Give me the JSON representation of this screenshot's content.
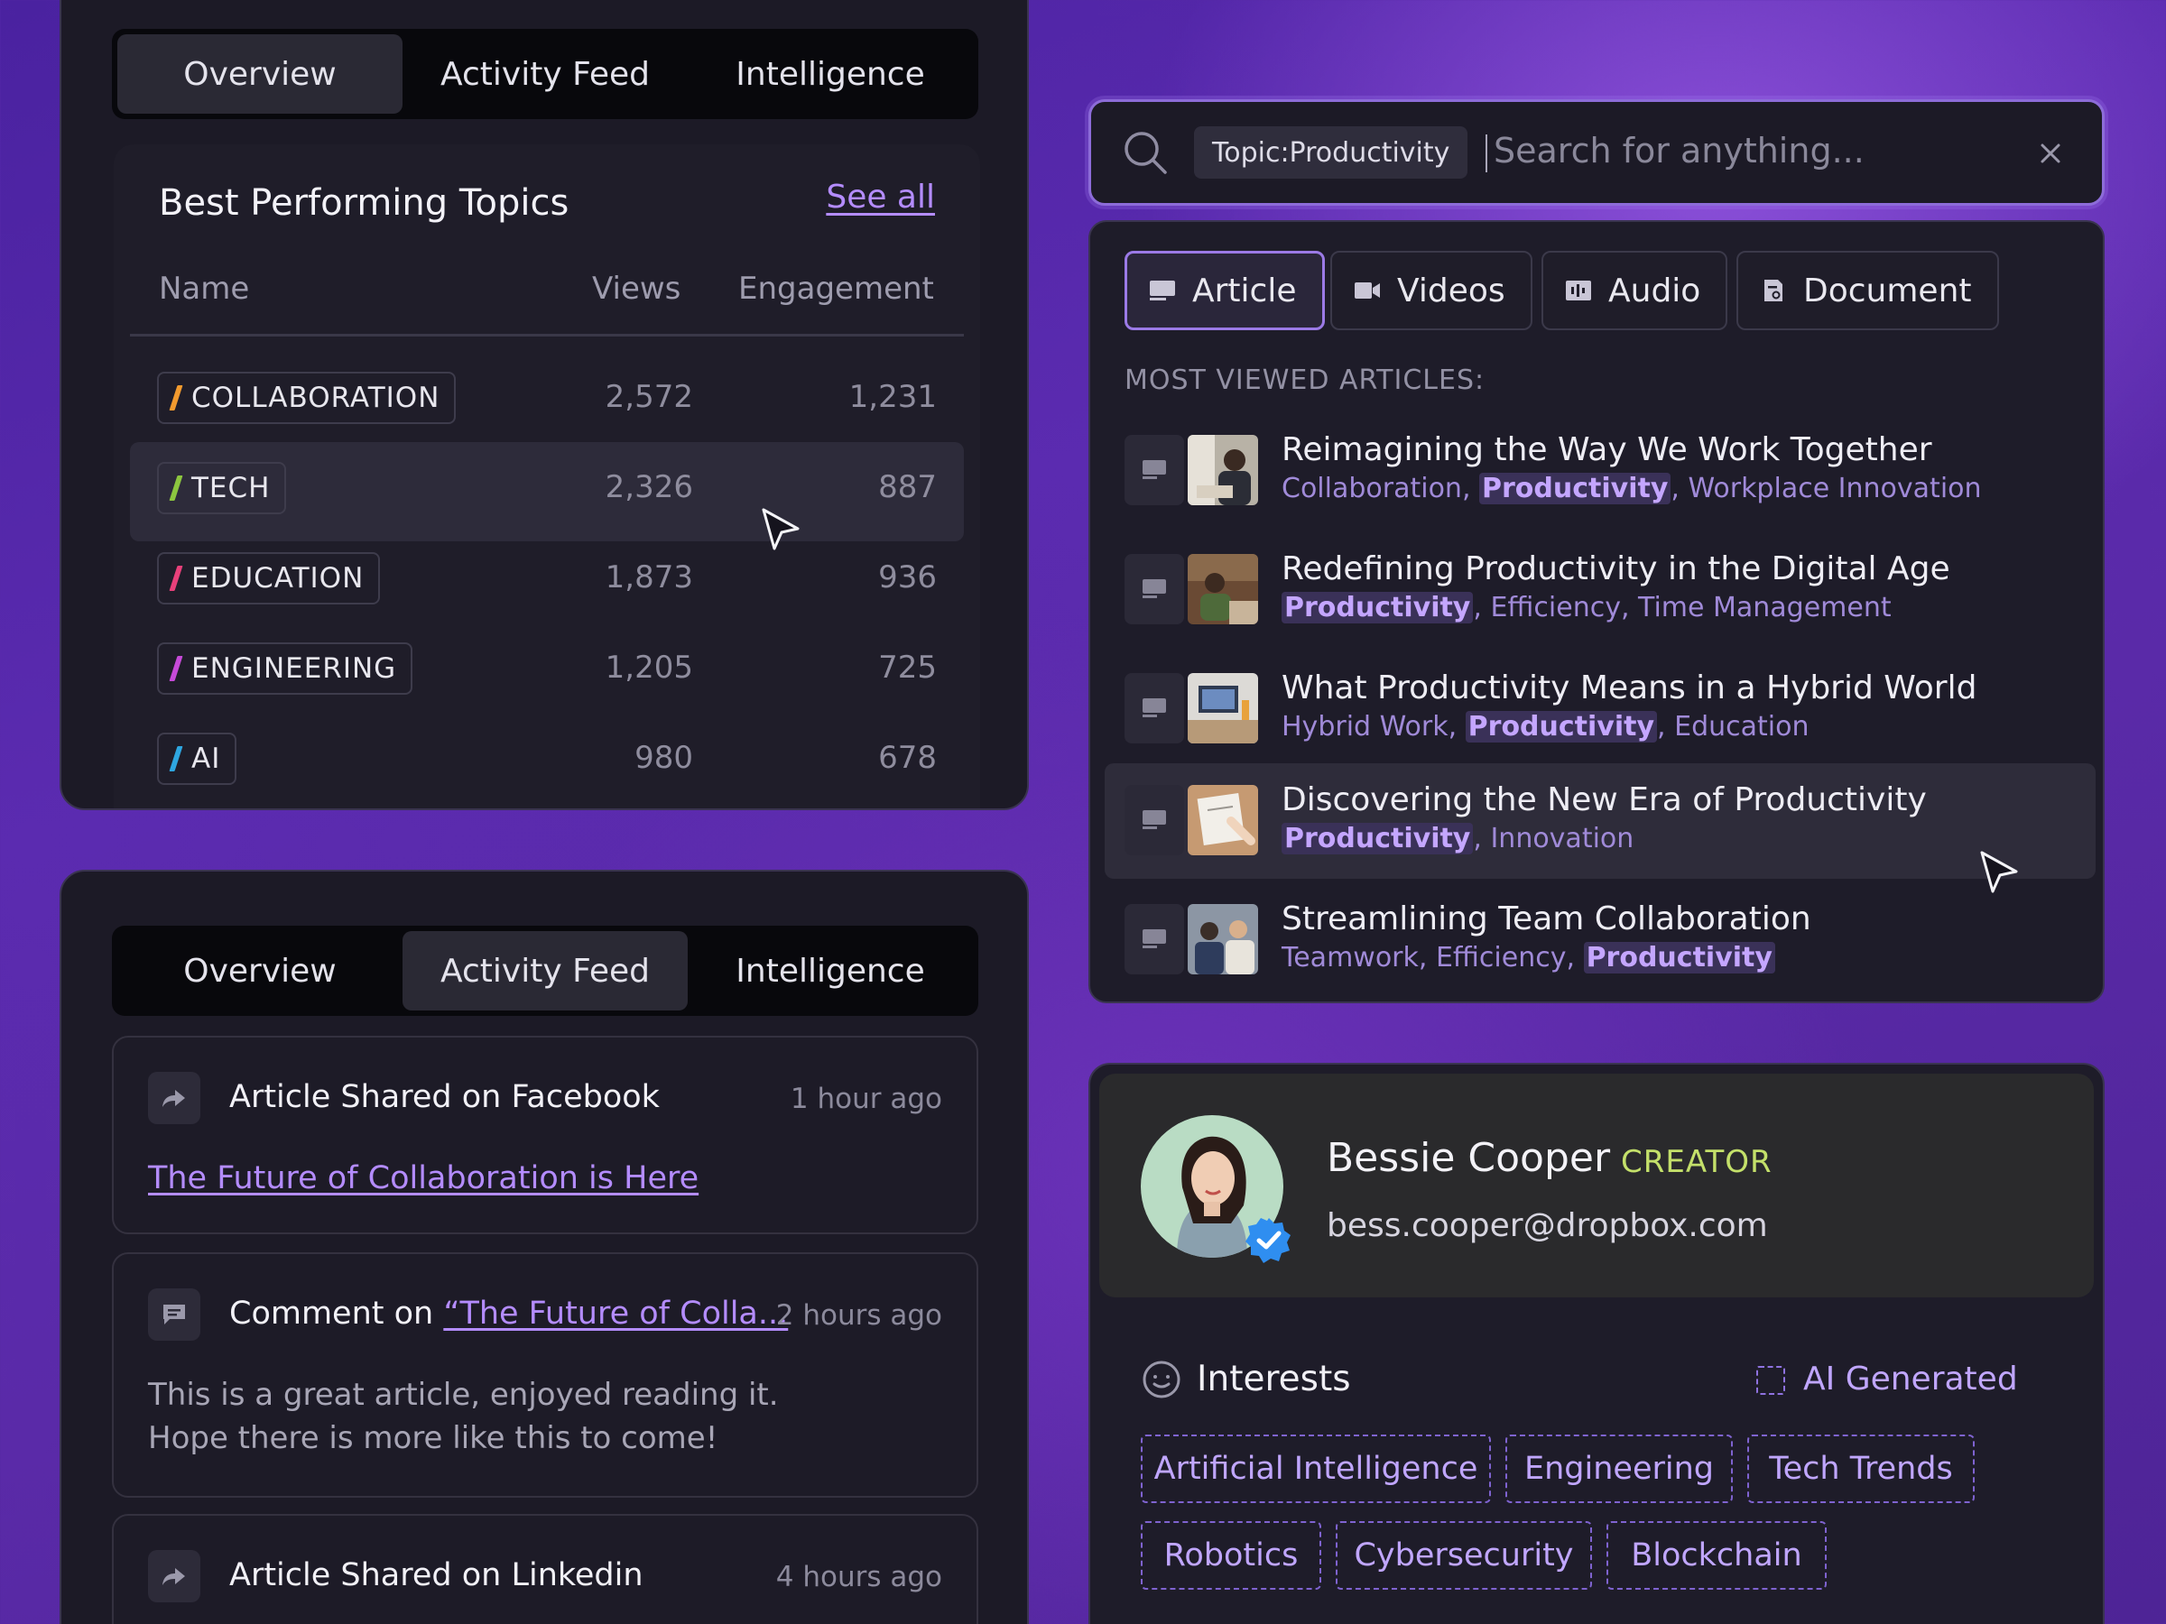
{
  "tabs": [
    "Overview",
    "Activity Feed",
    "Intelligence"
  ],
  "topics": {
    "title": "Best Performing Topics",
    "see_all": "See all",
    "columns": {
      "name": "Name",
      "views": "Views",
      "engagement": "Engagement"
    },
    "rows": [
      {
        "name": "COLLABORATION",
        "views": "2,572",
        "engagement": "1,231",
        "color": "#f29a2e"
      },
      {
        "name": "TECH",
        "views": "2,326",
        "engagement": "887",
        "color": "#8cc63f"
      },
      {
        "name": "EDUCATION",
        "views": "1,873",
        "engagement": "936",
        "color": "#e8407a"
      },
      {
        "name": "ENGINEERING",
        "views": "1,205",
        "engagement": "725",
        "color": "#c64ad8"
      },
      {
        "name": "AI",
        "views": "980",
        "engagement": "678",
        "color": "#2ea6e0"
      }
    ]
  },
  "feed": [
    {
      "title": "Article Shared on Facebook",
      "time": "1 hour ago",
      "link": "The Future of Collaboration is Here",
      "icon": "share-icon"
    },
    {
      "title_prefix": "Comment on ",
      "title_link": "“The Future of Colla...",
      "time": "2 hours ago",
      "body1": "This is a great article, enjoyed reading it.",
      "body2": "Hope there is more like this to come!",
      "icon": "comment-icon"
    },
    {
      "title": "Article Shared on Linkedin",
      "time": "4 hours ago",
      "icon": "share-icon"
    }
  ],
  "search": {
    "tag": "Topic:Productivity",
    "placeholder": "Search for anything..."
  },
  "filters": [
    "Article",
    "Videos",
    "Audio",
    "Document"
  ],
  "most_viewed_label": "MOST VIEWED ARTICLES:",
  "articles": [
    {
      "title": "Reimagining the Way We Work Together",
      "tags": [
        {
          "t": "Collaboration",
          "b": false
        },
        {
          "t": "Productivity",
          "b": true
        },
        {
          "t": "Workplace Innovation",
          "b": false
        }
      ]
    },
    {
      "title": "Redefining Productivity in the Digital Age",
      "tags": [
        {
          "t": "Productivity",
          "b": true
        },
        {
          "t": "Efficiency",
          "b": false
        },
        {
          "t": "Time Management",
          "b": false
        }
      ]
    },
    {
      "title": "What Productivity Means in a Hybrid World",
      "tags": [
        {
          "t": "Hybrid Work",
          "b": false
        },
        {
          "t": "Productivity",
          "b": true
        },
        {
          "t": "Education",
          "b": false
        }
      ]
    },
    {
      "title": "Discovering the New Era of Productivity",
      "tags": [
        {
          "t": "Productivity",
          "b": true
        },
        {
          "t": "Innovation",
          "b": false
        }
      ]
    },
    {
      "title": "Streamlining Team Collaboration",
      "tags": [
        {
          "t": "Teamwork",
          "b": false
        },
        {
          "t": "Efficiency",
          "b": false
        },
        {
          "t": "Productivity",
          "b": true
        }
      ]
    }
  ],
  "profile": {
    "name": "Bessie Cooper",
    "role": "CREATOR",
    "email": "bess.cooper@dropbox.com",
    "interests_label": "Interests",
    "ai_label": "AI Generated",
    "interests": [
      "Artificial Intelligence",
      "Engineering",
      "Tech Trends",
      "Robotics",
      "Cybersecurity",
      "Blockchain"
    ]
  }
}
